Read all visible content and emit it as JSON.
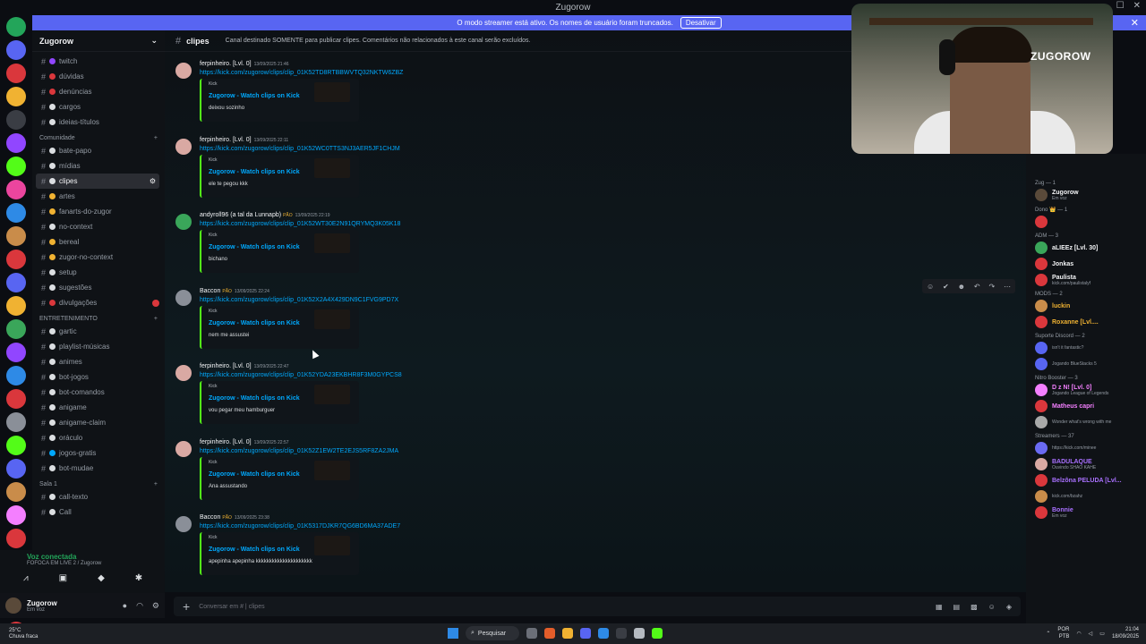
{
  "window": {
    "title": "Zugorow"
  },
  "banner": {
    "text": "O modo streamer está ativo. Os nomes de usuário foram truncados.",
    "button": "Desativar"
  },
  "server": {
    "name": "Zugorow"
  },
  "sidebar": {
    "top_channels": [
      {
        "name": "twitch",
        "color": "#9146ff"
      },
      {
        "name": "dúvidas",
        "color": "#da373c"
      },
      {
        "name": "denúncias",
        "color": "#da373c"
      },
      {
        "name": "cargos",
        "color": "#dbdee1"
      },
      {
        "name": "ideias-títulos",
        "color": "#dbdee1"
      }
    ],
    "categories": [
      {
        "name": "Comunidade",
        "channels": [
          {
            "name": "bate-papo",
            "color": "#dbdee1"
          },
          {
            "name": "mídias",
            "color": "#dbdee1"
          },
          {
            "name": "clipes",
            "color": "#dbdee1",
            "active": true
          },
          {
            "name": "artes",
            "color": "#f0b232"
          },
          {
            "name": "fanarts-do-zugor",
            "color": "#f0b232"
          },
          {
            "name": "no-context",
            "color": "#dbdee1"
          },
          {
            "name": "bereal",
            "color": "#f0b232"
          },
          {
            "name": "zugor-no-context",
            "color": "#f0b232"
          },
          {
            "name": "setup",
            "color": "#dbdee1"
          },
          {
            "name": "sugestões",
            "color": "#dbdee1"
          },
          {
            "name": "divulgações",
            "color": "#da373c",
            "unread": true
          }
        ]
      },
      {
        "name": "ENTRETENIMENTO",
        "channels": [
          {
            "name": "gartic",
            "color": "#dbdee1"
          },
          {
            "name": "playlist-músicas",
            "color": "#dbdee1"
          },
          {
            "name": "animes",
            "color": "#dbdee1"
          },
          {
            "name": "bot-jogos",
            "color": "#dbdee1"
          },
          {
            "name": "bot-comandos",
            "color": "#dbdee1"
          },
          {
            "name": "anigame",
            "color": "#dbdee1"
          },
          {
            "name": "anigame-claim",
            "color": "#dbdee1"
          },
          {
            "name": "oráculo",
            "color": "#dbdee1"
          },
          {
            "name": "jogos-gratis",
            "color": "#00a8fc"
          },
          {
            "name": "bot-mudae",
            "color": "#dbdee1"
          }
        ]
      },
      {
        "name": "Sala 1",
        "channels": [
          {
            "name": "call-texto",
            "color": "#dbdee1"
          },
          {
            "name": "Call",
            "color": "#dbdee1"
          }
        ]
      }
    ]
  },
  "voice": {
    "status": "Voz conectada",
    "detail": "FOFOCA EM LIVE 2 / Zugorow"
  },
  "user_panel": {
    "name": "Zugorow",
    "status": "Em voz"
  },
  "chat": {
    "channel": "clipes",
    "topic": "Canal destinado SOMENTE para publicar clipes. Comentários não relacionados à este canal serão excluídos.",
    "messages": [
      {
        "author": "ferpinheiro. [Lvl. 0]",
        "tag": "",
        "time": "13/09/2025 21:46",
        "link": "https://kick.com/zugorow/clips/clip_01K52TD8RTBBWVTQ32NKTW6ZBZ",
        "embed_provider": "Kick",
        "embed_title": "Zugorow - Watch clips on Kick",
        "embed_desc": "deixou sozinho",
        "avatar_color": "#d9a9a3"
      },
      {
        "author": "ferpinheiro. [Lvl. 0]",
        "tag": "",
        "time": "13/09/2025 22:11",
        "link": "https://kick.com/zugorow/clips/clip_01K52WC0TTS3NJ3AER5JF1CHJM",
        "embed_provider": "Kick",
        "embed_title": "Zugorow - Watch clips on Kick",
        "embed_desc": "ele te pegou kkk",
        "avatar_color": "#d9a9a3"
      },
      {
        "author": "andyroll96 (a tal da Lunnapb)",
        "tag": "PÃO",
        "time": "13/09/2025 22:19",
        "link": "https://kick.com/zugorow/clips/clip_01K52WT30E2N91QRYMQ3K05K18",
        "embed_provider": "Kick",
        "embed_title": "Zugorow - Watch clips on Kick",
        "embed_desc": "bichano",
        "avatar_color": "#3aa65a"
      },
      {
        "author": "Baccon",
        "tag": "PÃO",
        "time": "13/09/2025 22:24",
        "link": "https://kick.com/zugorow/clips/clip_01K52X2A4X429DN9C1FVG9PD7X",
        "embed_provider": "Kick",
        "embed_title": "Zugorow - Watch clips on Kick",
        "embed_desc": "nem me assustei",
        "avatar_color": "#8a8f98"
      },
      {
        "author": "ferpinheiro. [Lvl. 0]",
        "tag": "",
        "time": "13/09/2025 22:47",
        "link": "https://kick.com/zugorow/clips/clip_01K52YDA23EKBHR8F3M0GYPCS8",
        "embed_provider": "Kick",
        "embed_title": "Zugorow - Watch clips on Kick",
        "embed_desc": "vou pegar meu hamburguer",
        "avatar_color": "#d9a9a3"
      },
      {
        "author": "ferpinheiro. [Lvl. 0]",
        "tag": "",
        "time": "13/09/2025 22:57",
        "link": "https://kick.com/zugorow/clips/clip_01K52Z1EW2TE2EJS5RF8ZA2JMA",
        "embed_provider": "Kick",
        "embed_title": "Zugorow - Watch clips on Kick",
        "embed_desc": "Ana assustando",
        "avatar_color": "#d9a9a3"
      },
      {
        "author": "Baccon",
        "tag": "PÃO",
        "time": "13/09/2025 23:38",
        "link": "https://kick.com/zugorow/clips/clip_01K5317DJKR7QG6BD6MA37ADE7",
        "embed_provider": "Kick",
        "embed_title": "Zugorow - Watch clips on Kick",
        "embed_desc": "apepinha apepinha kkkkkkkkkkkkkkkkkkkkk",
        "avatar_color": "#8a8f98"
      }
    ],
    "composer_placeholder": "Conversar em # | clipes"
  },
  "members": {
    "groups": [
      {
        "name": "Zug — 1",
        "members": [
          {
            "name": "Zugorow",
            "status": "Em voz",
            "color": "#f2f3f5",
            "avatar": "#5a4a3a"
          }
        ]
      },
      {
        "name": "Dono 👑 — 1",
        "members": [
          {
            "name": "",
            "status": "",
            "color": "#f2f3f5",
            "avatar": "#da373c"
          }
        ]
      },
      {
        "name": "ADM — 3",
        "members": [
          {
            "name": "aLIEEz [Lvl. 30]",
            "status": "",
            "color": "#f2f3f5",
            "avatar": "#3aa65a"
          },
          {
            "name": "Jonkas",
            "status": "",
            "color": "#f2f3f5",
            "avatar": "#da373c"
          },
          {
            "name": "Paulista",
            "status": "kick.com/paulistalyf",
            "color": "#f2f3f5",
            "avatar": "#da373c"
          }
        ]
      },
      {
        "name": "MODS — 2",
        "members": [
          {
            "name": "luckin",
            "status": "",
            "color": "#f0b232",
            "avatar": "#c98c4a"
          },
          {
            "name": "Roxanne [Lvl....",
            "status": "",
            "color": "#f0b232",
            "avatar": "#da373c"
          }
        ]
      },
      {
        "name": "Suporte Discord — 2",
        "members": [
          {
            "name": "",
            "status": "isn't it fantastic?",
            "color": "#00a8fc",
            "avatar": "#5865f2"
          },
          {
            "name": "",
            "status": "Jogando BlueStacks 5",
            "color": "#00a8fc",
            "avatar": "#5865f2"
          }
        ]
      },
      {
        "name": "Nitro Booster — 3",
        "members": [
          {
            "name": "D z N! [Lvl. 0]",
            "status": "Jogando League of Legends",
            "color": "#f47fff",
            "avatar": "#f47fff"
          },
          {
            "name": "Matheus capri",
            "status": "",
            "color": "#f47fff",
            "avatar": "#da373c"
          },
          {
            "name": "",
            "status": "Wonder what's wrong with me",
            "color": "#f47fff",
            "avatar": "#a9a9a9"
          }
        ]
      },
      {
        "name": "Streamers — 37",
        "members": [
          {
            "name": "",
            "status": "https://kick.com/minee",
            "color": "#a970ff",
            "avatar": "#6a6af2"
          },
          {
            "name": "BADULAQUE",
            "status": "Ouvindo SHAO KAHE",
            "color": "#a970ff",
            "avatar": "#d9a9a3"
          },
          {
            "name": "Belzôna PELUDA [Lvl...",
            "status": "",
            "color": "#a970ff",
            "avatar": "#da373c"
          },
          {
            "name": "",
            "status": "kick.com/bzahz",
            "color": "#a970ff",
            "avatar": "#c98c4a"
          },
          {
            "name": "Bonnie",
            "status": "Em voz",
            "color": "#a970ff",
            "avatar": "#da373c"
          }
        ]
      }
    ]
  },
  "webcam": {
    "logo": "ZUGOROW"
  },
  "taskbar": {
    "weather": "25°C",
    "weather_desc": "Chuva fraca",
    "search": "Pesquisar",
    "lang": "POR",
    "lang2": "PTB",
    "time": "21:04",
    "date": "18/09/2025"
  },
  "colors": {
    "accent": "#5865f2",
    "link": "#00a8fc",
    "kick": "#53fc18"
  }
}
